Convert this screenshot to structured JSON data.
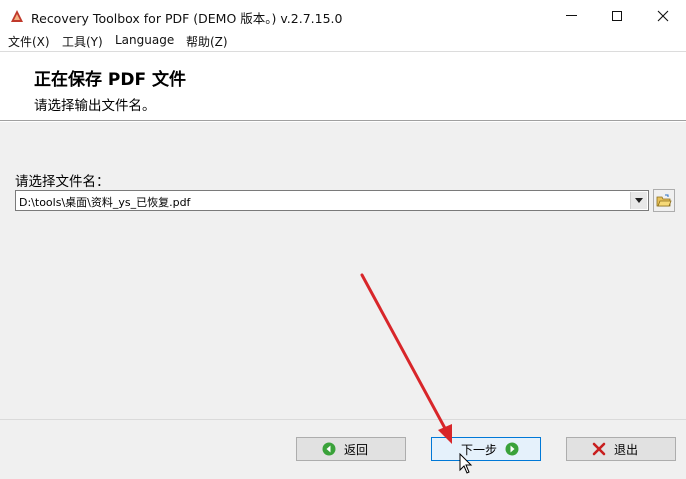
{
  "window": {
    "title": "Recovery Toolbox for PDF (DEMO 版本。) v.2.7.15.0"
  },
  "menu": {
    "items": [
      {
        "label": "文件(X)"
      },
      {
        "label": "工具(Y)"
      },
      {
        "label": "Language"
      },
      {
        "label": "帮助(Z)"
      }
    ]
  },
  "header": {
    "title": "正在保存 PDF 文件",
    "subtitle": "请选择输出文件名。"
  },
  "form": {
    "file_label": "请选择文件名：",
    "file_value": "D:\\tools\\桌面\\资料_ys_已恢复.pdf"
  },
  "buttons": {
    "back": "返回",
    "next": "下一步",
    "exit": "退出"
  },
  "colors": {
    "annotation_arrow": "#d8262a",
    "nav_icon_green": "#3aa23a",
    "exit_icon_red": "#c81e1e",
    "primary_border": "#0078d7"
  }
}
